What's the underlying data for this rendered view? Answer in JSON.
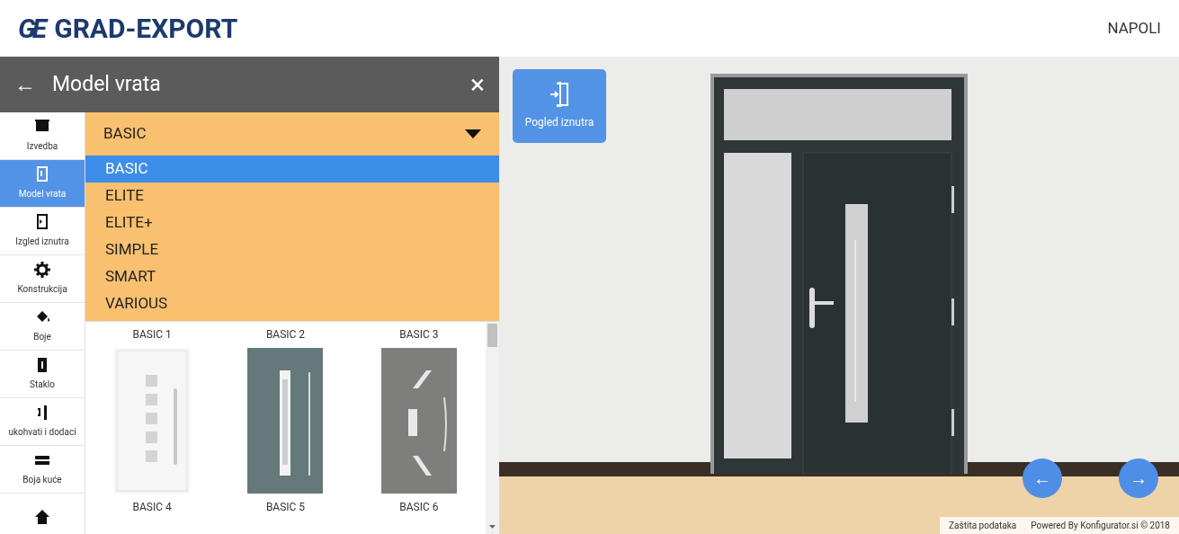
{
  "header": {
    "logo_mark": "GE",
    "logo_text": "GRAD-EXPORT",
    "model_name": "NAPOLI"
  },
  "panel": {
    "back": "←",
    "title": "Model vrata",
    "close": "×"
  },
  "sidebar": {
    "items": [
      {
        "label": "Izvedba",
        "selected": false
      },
      {
        "label": "Model vrata",
        "selected": true
      },
      {
        "label": "Izgled iznutra",
        "selected": false
      },
      {
        "label": "Konstrukcija",
        "selected": false
      },
      {
        "label": "Boje",
        "selected": false
      },
      {
        "label": "Staklo",
        "selected": false
      },
      {
        "label": "ukohvati i dodaci",
        "selected": false
      },
      {
        "label": "Boja kuće",
        "selected": false
      },
      {
        "selected": false
      }
    ]
  },
  "dropdown": {
    "value": "BASIC",
    "expanded": true,
    "options": [
      {
        "label": "BASIC",
        "selected": true
      },
      {
        "label": "ELITE",
        "selected": false
      },
      {
        "label": "ELITE+",
        "selected": false
      },
      {
        "label": "SIMPLE",
        "selected": false
      },
      {
        "label": "SMART",
        "selected": false
      },
      {
        "label": "VARIOUS",
        "selected": false
      }
    ]
  },
  "models": [
    {
      "label": "BASIC 1"
    },
    {
      "label": "BASIC 2"
    },
    {
      "label": "BASIC 3"
    },
    {
      "label": "BASIC 4"
    },
    {
      "label": "BASIC 5"
    },
    {
      "label": "BASIC 6"
    }
  ],
  "view": {
    "inside_button": "Pogled iznutra",
    "prev": "←",
    "next": "→",
    "privacy": "Zaštita podataka",
    "powered": "Powered By Konfigurator.si © 2018"
  }
}
